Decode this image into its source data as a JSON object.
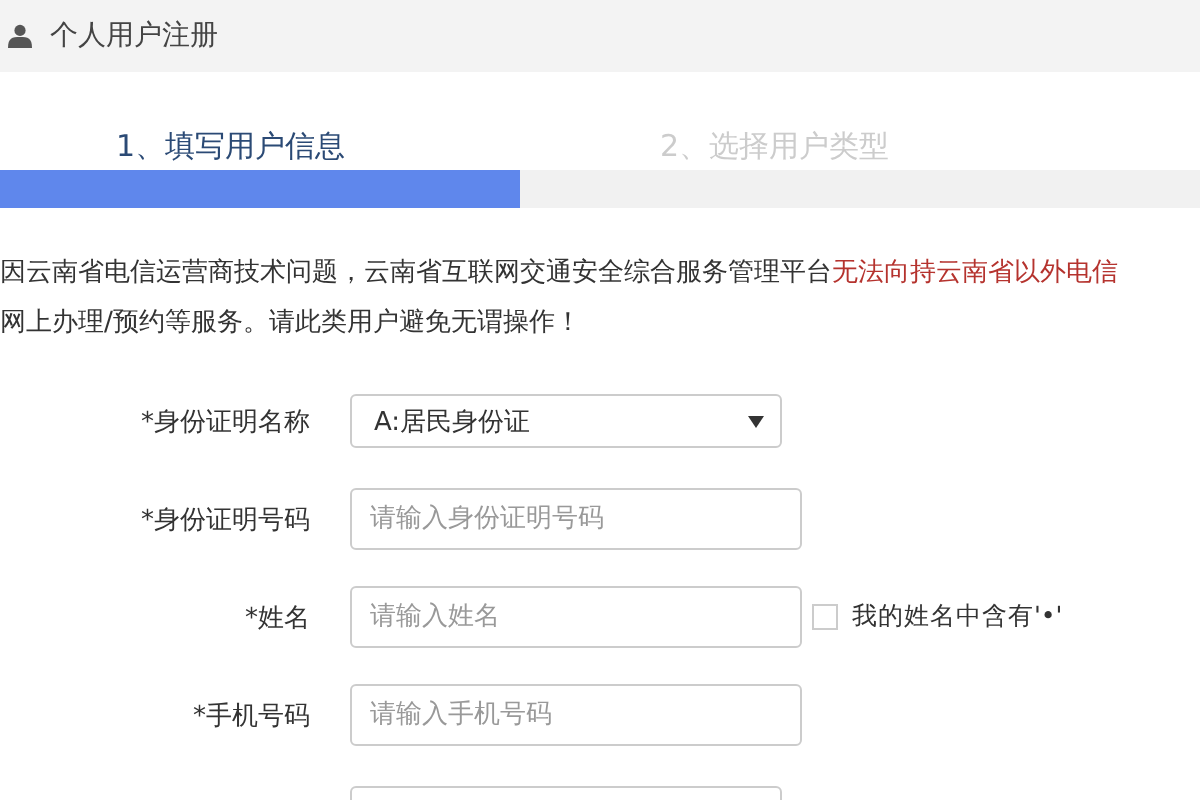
{
  "header": {
    "title": "个人用户注册"
  },
  "steps": [
    {
      "label": "1、填写用户信息",
      "selected": true
    },
    {
      "label": "2、选择用户类型",
      "selected": false
    }
  ],
  "progress": {
    "level": 0.433
  },
  "notice": [
    [
      {
        "text": "因云南省电信运营商技术问题，云南省互联网交通安全综合服务管理平台",
        "emphasis": false
      },
      {
        "text": "无法向持云南省以外电信",
        "emphasis": true
      }
    ],
    [
      {
        "text": "网上办理/预约等服务。请此类用户避免无谓操作！",
        "emphasis": false
      }
    ]
  ],
  "form": [
    {
      "kind": "select",
      "required": "*",
      "label": "身份证明名称",
      "value": "A:居民身份证"
    },
    {
      "kind": "input",
      "required": "*",
      "label": "身份证明号码",
      "placeholder": "请输入身份证明号码"
    },
    {
      "kind": "input",
      "required": "*",
      "label": "姓名",
      "placeholder": "请输入姓名",
      "checkbox": {
        "label": "我的姓名中含有'•'",
        "checked": false
      }
    },
    {
      "kind": "input",
      "required": "*",
      "label": "手机号码",
      "placeholder": "请输入手机号码"
    },
    {
      "kind": "select"
    }
  ]
}
